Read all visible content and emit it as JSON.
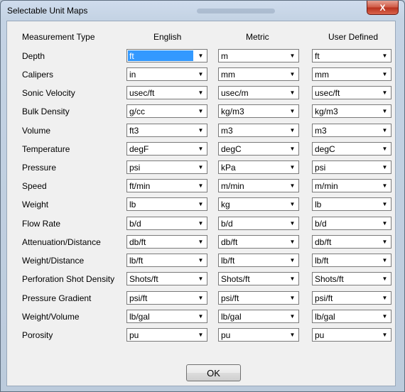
{
  "window": {
    "title": "Selectable Unit Maps",
    "close_label": "X"
  },
  "headers": {
    "type": "Measurement Type",
    "english": "English",
    "metric": "Metric",
    "user": "User Defined"
  },
  "rows": [
    {
      "label": "Depth",
      "english": "ft",
      "metric": "m",
      "user": "ft"
    },
    {
      "label": "Calipers",
      "english": "in",
      "metric": "mm",
      "user": "mm"
    },
    {
      "label": "Sonic Velocity",
      "english": "usec/ft",
      "metric": "usec/m",
      "user": "usec/ft"
    },
    {
      "label": "Bulk Density",
      "english": "g/cc",
      "metric": "kg/m3",
      "user": "kg/m3"
    },
    {
      "label": "Volume",
      "english": "ft3",
      "metric": "m3",
      "user": "m3"
    },
    {
      "label": "Temperature",
      "english": "degF",
      "metric": "degC",
      "user": "degC"
    },
    {
      "label": "Pressure",
      "english": "psi",
      "metric": "kPa",
      "user": "psi"
    },
    {
      "label": "Speed",
      "english": "ft/min",
      "metric": "m/min",
      "user": "m/min"
    },
    {
      "label": "Weight",
      "english": "lb",
      "metric": "kg",
      "user": "lb"
    },
    {
      "label": "Flow Rate",
      "english": "b/d",
      "metric": "b/d",
      "user": "b/d"
    },
    {
      "label": "Attenuation/Distance",
      "english": "db/ft",
      "metric": "db/ft",
      "user": "db/ft"
    },
    {
      "label": "Weight/Distance",
      "english": "lb/ft",
      "metric": "lb/ft",
      "user": "lb/ft"
    },
    {
      "label": "Perforation Shot Density",
      "english": "Shots/ft",
      "metric": "Shots/ft",
      "user": "Shots/ft"
    },
    {
      "label": "Pressure Gradient",
      "english": "psi/ft",
      "metric": "psi/ft",
      "user": "psi/ft"
    },
    {
      "label": "Weight/Volume",
      "english": "lb/gal",
      "metric": "lb/gal",
      "user": "lb/gal"
    },
    {
      "label": "Porosity",
      "english": "pu",
      "metric": "pu",
      "user": "pu"
    }
  ],
  "ok_label": "OK",
  "colors": {
    "selection": "#3399ff",
    "close_button": "#c9462f"
  },
  "icons": {
    "dropdown": "chevron-down-icon",
    "close": "close-icon"
  }
}
